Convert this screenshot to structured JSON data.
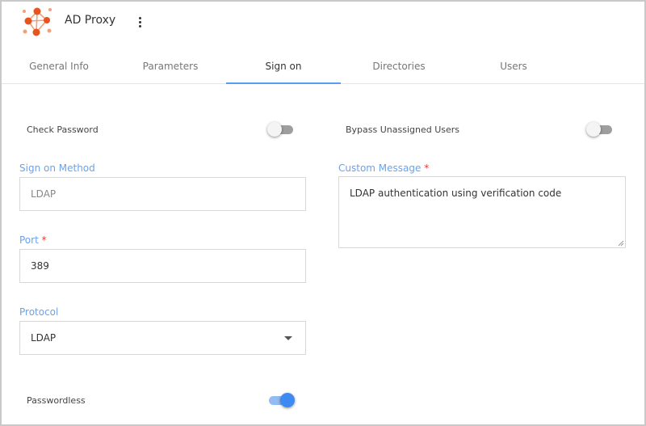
{
  "app": {
    "title": "AD Proxy",
    "logo_icon": "network-nodes-icon",
    "menu_icon": "kebab-menu-icon"
  },
  "tabs": [
    {
      "label": "General Info",
      "active": false
    },
    {
      "label": "Parameters",
      "active": false
    },
    {
      "label": "Sign on",
      "active": true
    },
    {
      "label": "Directories",
      "active": false
    },
    {
      "label": "Users",
      "active": false
    }
  ],
  "form": {
    "check_password": {
      "label": "Check Password",
      "enabled": false
    },
    "bypass_unassigned": {
      "label": "Bypass Unassigned Users",
      "enabled": false
    },
    "sign_on_method": {
      "label": "Sign on Method",
      "value": "LDAP"
    },
    "custom_message": {
      "label": "Custom Message",
      "required_mark": "*",
      "value": "LDAP authentication using verification code"
    },
    "port": {
      "label": "Port",
      "required_mark": "*",
      "value": "389"
    },
    "protocol": {
      "label": "Protocol",
      "value": "LDAP"
    },
    "passwordless": {
      "label": "Passwordless",
      "enabled": true
    }
  },
  "colors": {
    "accent": "#5b9cf0",
    "label_blue": "#6aa2ee",
    "required": "#e53935",
    "toggle_on": "#3d8bf2",
    "logo": "#e8541e"
  }
}
